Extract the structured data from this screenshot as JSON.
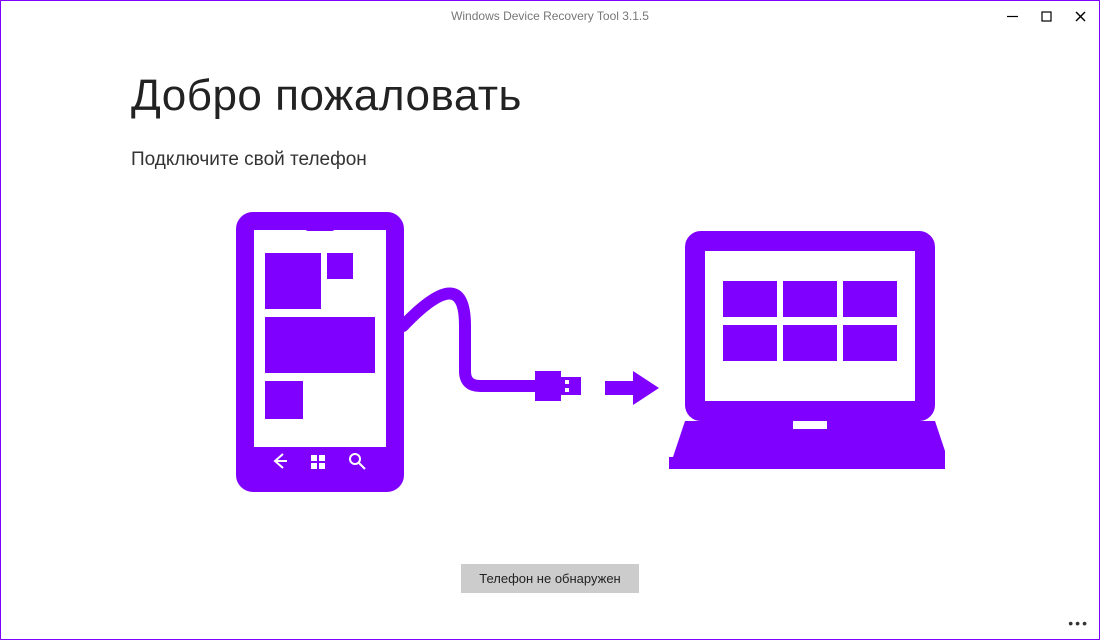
{
  "window": {
    "title": "Windows Device Recovery Tool 3.1.5"
  },
  "page": {
    "heading": "Добро пожаловать",
    "subheading": "Подключите свой телефон"
  },
  "buttons": {
    "phone_not_detected": "Телефон не обнаружен"
  },
  "colors": {
    "accent": "#8000ff"
  }
}
